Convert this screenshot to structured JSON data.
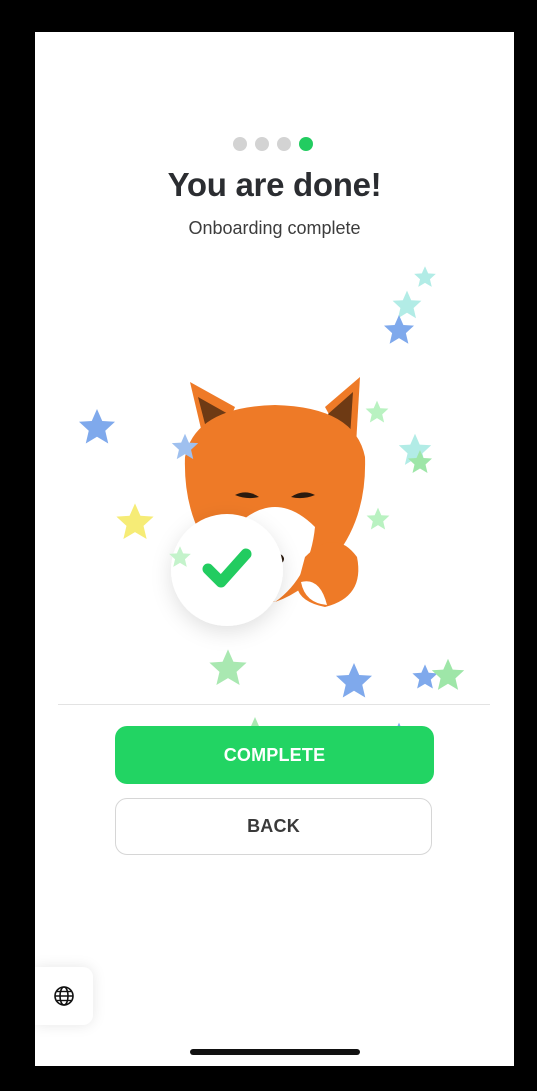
{
  "progress": {
    "total_steps": 4,
    "current_step": 4,
    "active_color": "#22cc60",
    "inactive_color": "#d3d3d3"
  },
  "header": {
    "title": "You are done!",
    "subtitle": "Onboarding complete"
  },
  "illustration": {
    "character": "fox-mascot",
    "badge_icon": "checkmark-icon",
    "decoration": "confetti-stars"
  },
  "actions": {
    "complete_label": "COMPLETE",
    "back_label": "BACK",
    "primary_color": "#22d463"
  },
  "footer": {
    "language_icon": "globe-icon"
  }
}
